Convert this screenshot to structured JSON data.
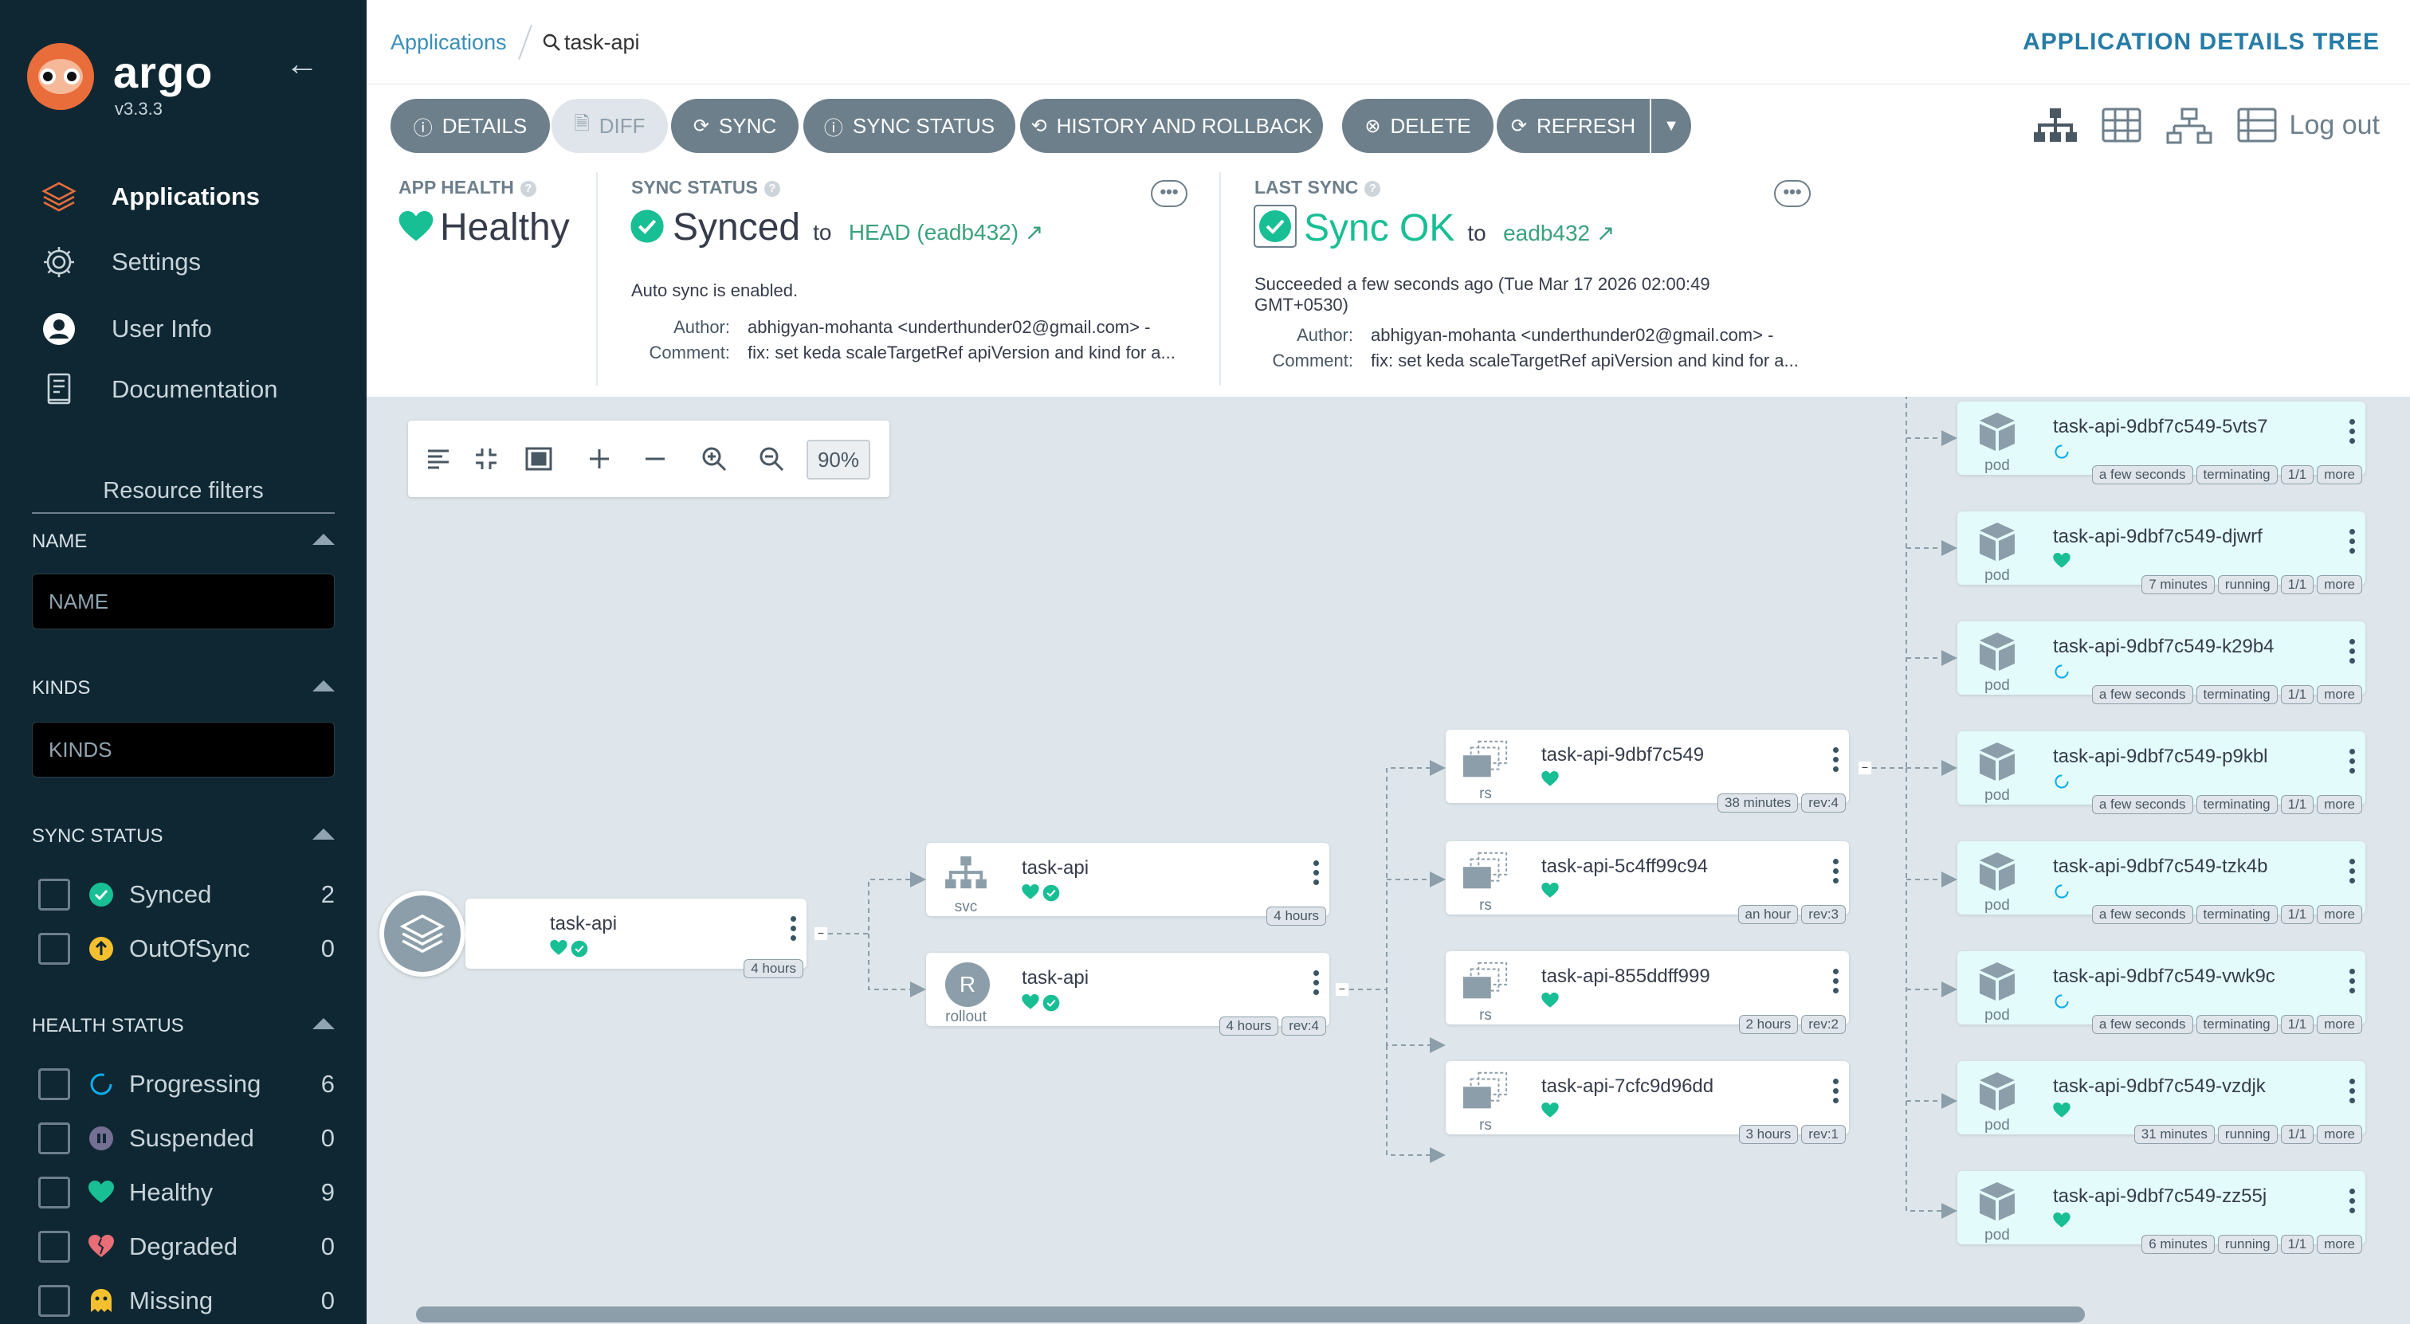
{
  "app": {
    "brand": "argo",
    "version": "v3.3.3"
  },
  "nav": [
    {
      "label": "Applications",
      "icon": "layers-icon",
      "active": true
    },
    {
      "label": "Settings",
      "icon": "gear-icon",
      "active": false
    },
    {
      "label": "User Info",
      "icon": "user-icon",
      "active": false
    },
    {
      "label": "Documentation",
      "icon": "book-icon",
      "active": false
    }
  ],
  "filters": {
    "title": "Resource filters",
    "name_label": "NAME",
    "name_placeholder": "NAME",
    "kinds_label": "KINDS",
    "kinds_placeholder": "KINDS",
    "sync_label": "SYNC STATUS",
    "sync_items": [
      {
        "label": "Synced",
        "count": "2",
        "color": "#18be94"
      },
      {
        "label": "OutOfSync",
        "count": "0",
        "color": "#f4c030"
      }
    ],
    "health_label": "HEALTH STATUS",
    "health_items": [
      {
        "label": "Progressing",
        "count": "6",
        "color": "#0dadea"
      },
      {
        "label": "Suspended",
        "count": "0",
        "color": "#766f94"
      },
      {
        "label": "Healthy",
        "count": "9",
        "color": "#18be94"
      },
      {
        "label": "Degraded",
        "count": "0",
        "color": "#e96d76"
      },
      {
        "label": "Missing",
        "count": "0",
        "color": "#f4c030"
      }
    ]
  },
  "breadcrumb": {
    "parent": "Applications",
    "current": "task-api"
  },
  "page_label": "APPLICATION DETAILS TREE",
  "toolbar": {
    "details": "DETAILS",
    "diff": "DIFF",
    "sync": "SYNC",
    "sync_status": "SYNC STATUS",
    "history": "HISTORY AND ROLLBACK",
    "delete": "DELETE",
    "refresh": "REFRESH",
    "logout": "Log out"
  },
  "status": {
    "app_health_title": "APP HEALTH",
    "app_health": "Healthy",
    "sync_title": "SYNC STATUS",
    "sync_value": "Synced",
    "sync_to": "to",
    "sync_revision": "HEAD (eadb432)",
    "auto_sync": "Auto sync is enabled.",
    "author_label": "Author:",
    "author": "abhigyan-mohanta <underthunder02@gmail.com> -",
    "comment_label": "Comment:",
    "comment": "fix: set keda scaleTargetRef apiVersion and kind for a...",
    "last_sync_title": "LAST SYNC",
    "last_sync_value": "Sync OK",
    "last_sync_to": "to",
    "last_sync_revision": "eadb432",
    "succeeded_line1": "Succeeded a few seconds ago (Tue Mar 17 2026 02:00:49",
    "succeeded_line2": "GMT+0530)",
    "ls_author_label": "Author:",
    "ls_author": "abhigyan-mohanta <underthunder02@gmail.com> -",
    "ls_comment_label": "Comment:",
    "ls_comment": "fix: set keda scaleTargetRef apiVersion and kind for a..."
  },
  "graph": {
    "zoom": "90%",
    "app_node": {
      "name": "task-api",
      "tags": [
        "4 hours"
      ]
    },
    "svc_node": {
      "name": "task-api",
      "kind": "svc",
      "tags": [
        "4 hours"
      ]
    },
    "rollout_node": {
      "name": "task-api",
      "kind": "rollout",
      "letter": "R",
      "tags": [
        "4 hours",
        "rev:4"
      ]
    },
    "rs_nodes": [
      {
        "name": "task-api-9dbf7c549",
        "kind": "rs",
        "tags": [
          "38 minutes",
          "rev:4"
        ]
      },
      {
        "name": "task-api-5c4ff99c94",
        "kind": "rs",
        "tags": [
          "an hour",
          "rev:3"
        ]
      },
      {
        "name": "task-api-855ddff999",
        "kind": "rs",
        "tags": [
          "2 hours",
          "rev:2"
        ]
      },
      {
        "name": "task-api-7cfc9d96dd",
        "kind": "rs",
        "tags": [
          "3 hours",
          "rev:1"
        ]
      }
    ],
    "pod_nodes": [
      {
        "name": "task-api-9dbf7c549-5vts7",
        "kind": "pod",
        "health": "progressing",
        "tags": [
          "a few seconds",
          "terminating",
          "1/1",
          "more"
        ]
      },
      {
        "name": "task-api-9dbf7c549-djwrf",
        "kind": "pod",
        "health": "healthy",
        "tags": [
          "7 minutes",
          "running",
          "1/1",
          "more"
        ]
      },
      {
        "name": "task-api-9dbf7c549-k29b4",
        "kind": "pod",
        "health": "progressing",
        "tags": [
          "a few seconds",
          "terminating",
          "1/1",
          "more"
        ]
      },
      {
        "name": "task-api-9dbf7c549-p9kbl",
        "kind": "pod",
        "health": "progressing",
        "tags": [
          "a few seconds",
          "terminating",
          "1/1",
          "more"
        ]
      },
      {
        "name": "task-api-9dbf7c549-tzk4b",
        "kind": "pod",
        "health": "progressing",
        "tags": [
          "a few seconds",
          "terminating",
          "1/1",
          "more"
        ]
      },
      {
        "name": "task-api-9dbf7c549-vwk9c",
        "kind": "pod",
        "health": "progressing",
        "tags": [
          "a few seconds",
          "terminating",
          "1/1",
          "more"
        ]
      },
      {
        "name": "task-api-9dbf7c549-vzdjk",
        "kind": "pod",
        "health": "healthy",
        "tags": [
          "31 minutes",
          "running",
          "1/1",
          "more"
        ]
      },
      {
        "name": "task-api-9dbf7c549-zz55j",
        "kind": "pod",
        "health": "healthy",
        "tags": [
          "6 minutes",
          "running",
          "1/1",
          "more"
        ]
      }
    ]
  },
  "colors": {
    "healthy": "#18be94",
    "progressing": "#0dadea",
    "accent": "#267ca6"
  }
}
